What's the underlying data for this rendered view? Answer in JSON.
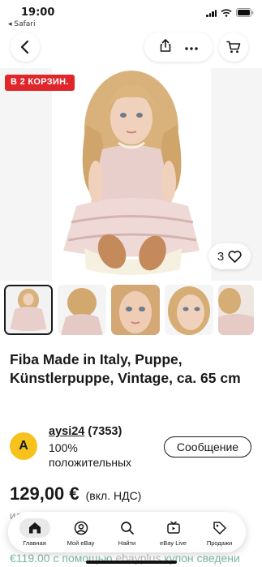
{
  "status_bar": {
    "time": "19:00",
    "back_app": "◂ Safari",
    "icons": [
      "signal-icon",
      "wifi-icon",
      "battery-icon"
    ]
  },
  "nav": {
    "icons": [
      "chevron-left-icon",
      "share-icon",
      "more-icon",
      "cart-icon"
    ]
  },
  "listing": {
    "badge": "В 2 КОРЗИН.",
    "watch_count": "3",
    "title": "Fiba Made in Italy, Puppe, Künstlerpuppe, Vintage, ca. 65 cm",
    "thumbnail_count": 5,
    "price": "129,00 €",
    "vat_note": "(вкл. НДС)",
    "partial_text": "ил",
    "promo_price": "€119.00",
    "promo_with": "с помощью",
    "promo_brand": "ebayplus",
    "promo_coupon": "купон",
    "promo_more": "сведени"
  },
  "seller": {
    "avatar_letter": "A",
    "name": "aysi24",
    "rating": "(7353)",
    "feedback": "100% положительных",
    "message_button": "Сообщение"
  },
  "tab_bar": {
    "items": [
      {
        "label": "Главная",
        "icon": "home-icon",
        "active": true
      },
      {
        "label": "Мой eBay",
        "icon": "user-icon",
        "active": false
      },
      {
        "label": "Найти",
        "icon": "search-icon",
        "active": false
      },
      {
        "label": "eBay Live",
        "icon": "live-icon",
        "active": false
      },
      {
        "label": "Продажи",
        "icon": "tag-icon",
        "active": false
      }
    ]
  },
  "colors": {
    "badge": "#e0262b",
    "avatar": "#f7c21b",
    "text": "#191919",
    "promo": "#7fb7a8"
  }
}
